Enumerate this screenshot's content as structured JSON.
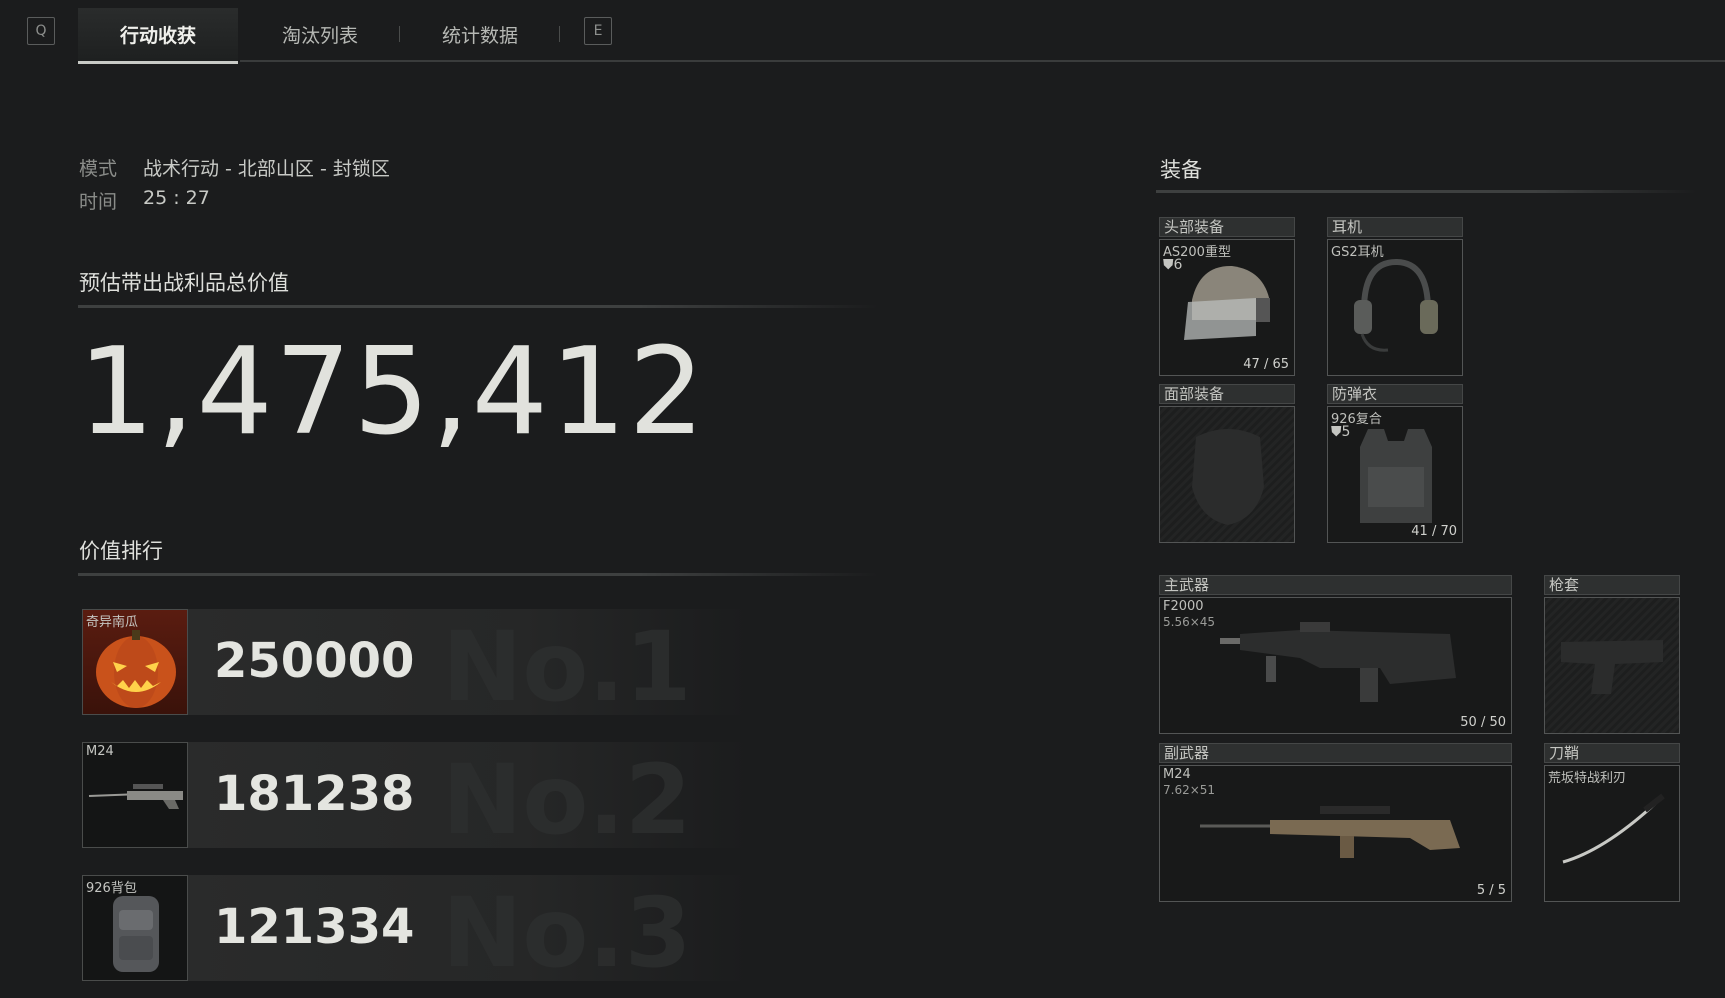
{
  "topbar": {
    "left_key": "Q",
    "right_key": "E",
    "tabs": [
      {
        "label": "行动收获",
        "active": true
      },
      {
        "label": "淘汰列表",
        "active": false
      },
      {
        "label": "统计数据",
        "active": false
      }
    ]
  },
  "meta": {
    "mode_label": "模式",
    "mode_value": "战术行动 - 北部山区 - 封锁区",
    "time_label": "时间",
    "time_value": "25 : 27"
  },
  "loot": {
    "title": "预估带出战利品总价值",
    "total": "1,475,412"
  },
  "ranking": {
    "title": "价值排行",
    "items": [
      {
        "name": "奇异南瓜",
        "value": "250000",
        "rank": "No.1"
      },
      {
        "name": "M24",
        "value": "181238",
        "rank": "No.2"
      },
      {
        "name": "926背包",
        "value": "121334",
        "rank": "No.3"
      }
    ]
  },
  "equipment": {
    "title": "装备",
    "head": {
      "label": "头部装备",
      "name": "AS200重型",
      "armor_level": "6",
      "durability": "47 / 65"
    },
    "headset": {
      "label": "耳机",
      "name": "GS2耳机"
    },
    "face": {
      "label": "面部装备"
    },
    "vest": {
      "label": "防弹衣",
      "name": "926复合",
      "armor_level": "5",
      "durability": "41 / 70"
    },
    "primary": {
      "label": "主武器",
      "name": "F2000",
      "caliber": "5.56×45",
      "ammo": "50 / 50"
    },
    "holster": {
      "label": "枪套"
    },
    "secondary": {
      "label": "副武器",
      "name": "M24",
      "caliber": "7.62×51",
      "ammo": "5 / 5"
    },
    "sheath": {
      "label": "刀鞘",
      "name": "荒坂特战利刃"
    }
  },
  "colors": {
    "background": "#1b1c1d",
    "accent": "#c8cac6",
    "pumpkin": "#d2581f"
  }
}
